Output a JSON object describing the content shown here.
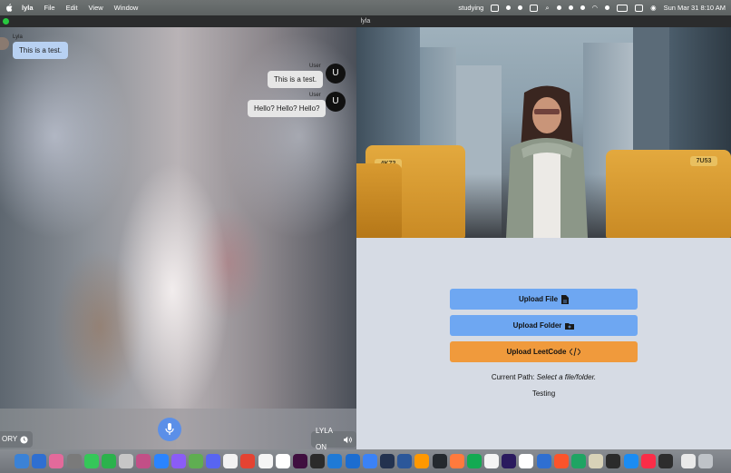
{
  "menubar": {
    "app_name": "lyla",
    "menus": [
      "File",
      "Edit",
      "View",
      "Window"
    ],
    "status_text": "studying",
    "datetime": "Sun Mar 31  8:10 AM"
  },
  "window": {
    "title": "lyla"
  },
  "chat": {
    "messages": [
      {
        "sender": "Lyla",
        "text": "This is a test."
      },
      {
        "sender": "User",
        "avatar": "U",
        "text": "This is a test."
      },
      {
        "sender": "User",
        "avatar": "U",
        "text": "Hello? Hello? Hello?"
      }
    ],
    "history_label": "ORY",
    "voice_label": "LYLA ON"
  },
  "panel": {
    "upload_file": "Upload File",
    "upload_folder": "Upload Folder",
    "upload_leetcode": "Upload LeetCode",
    "path_prefix": "Current Path:",
    "path_value": "Select a file/folder.",
    "status": "Testing"
  },
  "scene": {
    "taxi_left_sign": "4K72",
    "taxi_right_sign": "7U53"
  },
  "colors": {
    "accent_blue": "#6ea7f2",
    "accent_orange": "#f09a3c",
    "mic_blue": "#5b8fe8",
    "lyla_bubble": "#b8d1f2"
  },
  "dock": {
    "apps": [
      "finder-icon",
      "cloud-icon",
      "photos-icon",
      "settings-icon",
      "messages-icon",
      "facetime-icon",
      "launchpad-icon",
      "preview-icon",
      "appstore-icon",
      "messenger-icon",
      "maps-icon",
      "discord-icon",
      "calendar-icon",
      "todoist-icon",
      "notes-icon",
      "notion-icon",
      "slack-icon",
      "terminal-icon",
      "vscode-icon",
      "xcode-icon",
      "translate-icon",
      "vpn-icon",
      "word-icon",
      "sublime-icon",
      "github-icon",
      "pencil-icon",
      "mongodb-icon",
      "chrome-icon",
      "premiere-icon",
      "reminders-icon",
      "finder2-icon",
      "brave-icon",
      "sheets-icon",
      "typewriter-icon",
      "terminal2-icon",
      "safari-icon",
      "music-icon",
      "sync-icon",
      "files-icon",
      "trash-icon"
    ],
    "app_colors": [
      "#3b82d6",
      "#2f6fd1",
      "#e36a9b",
      "#7a7a7a",
      "#35c759",
      "#2bb24c",
      "#c7c7c7",
      "#c24f87",
      "#2a84ff",
      "#8b5cf6",
      "#5fae51",
      "#5865f2",
      "#f2f2f2",
      "#e44332",
      "#f5f5f5",
      "#ffffff",
      "#3f0f3f",
      "#2b2b2b",
      "#1f7ad6",
      "#1c6dd0",
      "#3b82f6",
      "#23324f",
      "#2b579a",
      "#ff9800",
      "#24292e",
      "#ff7a3d",
      "#13aa52",
      "#f4f4f4",
      "#2a1a5e",
      "#ffffff",
      "#2f6fd1",
      "#fb542b",
      "#1fa463",
      "#d8d2b8",
      "#2b2b2b",
      "#1b8cf2",
      "#fa2d48",
      "#2d2d2d",
      "#e9e9e9",
      "#bfc3c8"
    ]
  }
}
